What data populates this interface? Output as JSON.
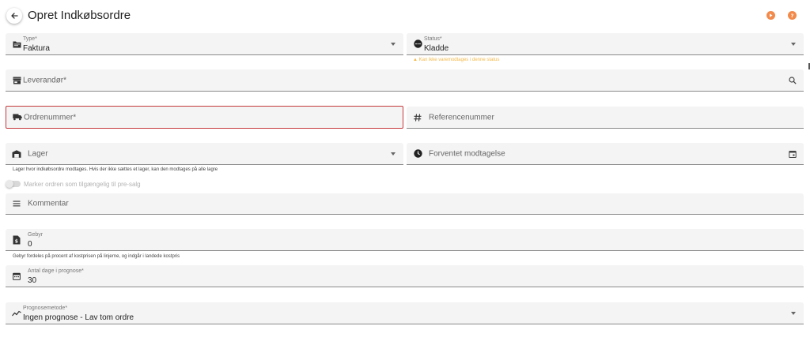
{
  "header": {
    "title": "Opret Indkøbsordre",
    "accent_color": "#f28a4b"
  },
  "fields": {
    "type": {
      "label": "Type*",
      "value": "Faktura",
      "icon": "folder-icon"
    },
    "status": {
      "label": "Status*",
      "value": "Kladde",
      "icon": "more-circle-icon",
      "warning": "Kan ikke varemodtages i denne status"
    },
    "supplier": {
      "placeholder": "Leverandør*",
      "icon": "store-icon"
    },
    "order_number": {
      "placeholder": "Ordrenummer*",
      "icon": "truck-icon"
    },
    "reference_number": {
      "placeholder": "Referencenummer",
      "icon": "hash-icon"
    },
    "warehouse": {
      "placeholder": "Lager",
      "icon": "warehouse-icon",
      "hint": "Lager hvor indkøbsordre modtages. Hvis der ikke sættes et lager, kan den modtages på alle lagre"
    },
    "expected_receipt": {
      "placeholder": "Forventet modtagelse",
      "icon": "clock-icon"
    },
    "presale_toggle": {
      "label": "Marker ordren som tilgængelig til pre-salg",
      "checked": false
    },
    "comment": {
      "placeholder": "Kommentar",
      "icon": "lines-icon"
    },
    "fee": {
      "label": "Gebyr",
      "value": "0",
      "icon": "dollar-doc-icon",
      "hint": "Gebyr fordeles på procent af kostprisen på linjerne, og indgår i landede kostpris"
    },
    "forecast_days": {
      "label": "Antal dage i prognose*",
      "value": "30",
      "icon": "calendar-icon"
    },
    "forecast_method": {
      "label": "Prognosemetode*",
      "value": "Ingen prognose - Lav tom ordre",
      "icon": "trend-icon"
    }
  }
}
